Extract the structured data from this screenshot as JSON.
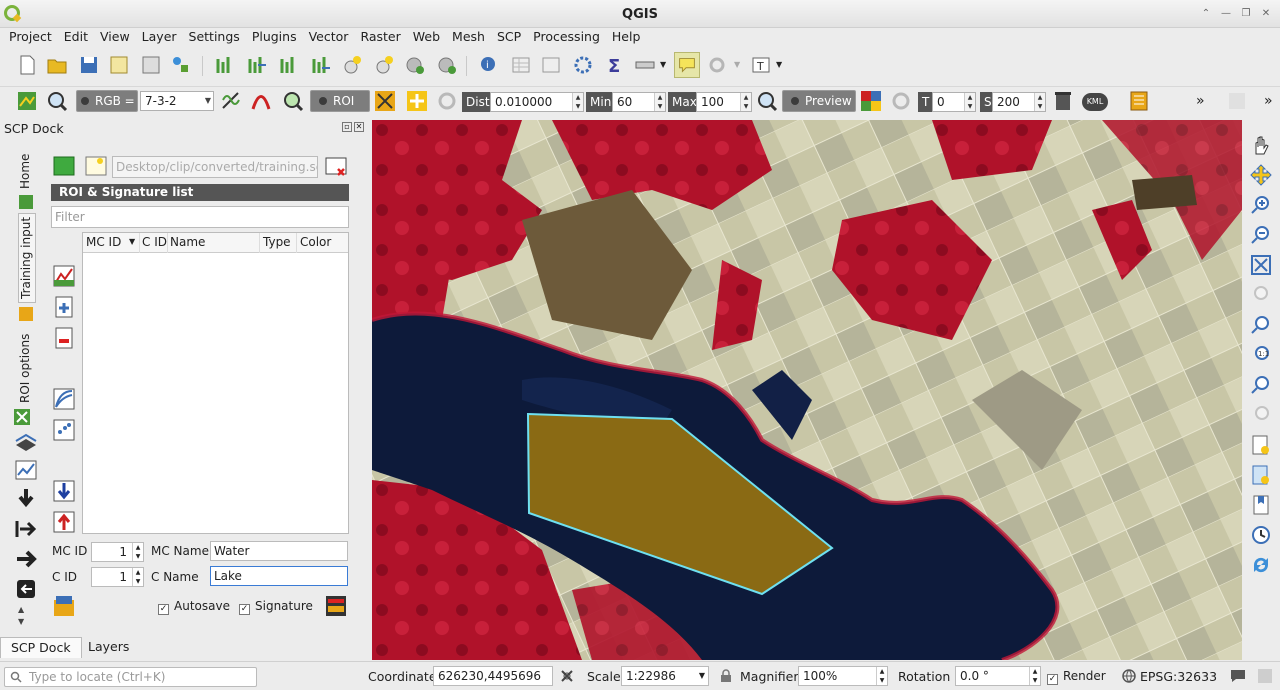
{
  "window": {
    "title": "QGIS"
  },
  "menu": [
    "Project",
    "Edit",
    "View",
    "Layer",
    "Settings",
    "Plugins",
    "Vector",
    "Raster",
    "Web",
    "Mesh",
    "SCP",
    "Processing",
    "Help"
  ],
  "scp_toolbar": {
    "rgb_label": "RGB =",
    "rgb_value": "7-3-2",
    "roi_button": "ROI",
    "dist_label": "Dist",
    "dist_value": "0.010000",
    "min_label": "Min",
    "min_value": "60",
    "max_label": "Max",
    "max_value": "100",
    "preview_button": "Preview",
    "t_label": "T",
    "t_value": "0",
    "s_label": "S",
    "s_value": "200",
    "kml_label": "KML",
    "overflow": "»"
  },
  "dock": {
    "title": "SCP Dock",
    "vertical_tabs": [
      "Home",
      "Training input",
      "ROI options"
    ],
    "training_file": "Desktop/clip/converted/training.scp",
    "roi_list_title": "ROI & Signature list",
    "filter_placeholder": "Filter",
    "table_headers": [
      "MC ID",
      "C ID",
      "Name",
      "Type",
      "Color"
    ],
    "table_rows": [],
    "mc_id_label": "MC ID",
    "mc_id_value": "1",
    "mc_name_label": "MC Name",
    "mc_name_value": "Water",
    "c_id_label": "C ID",
    "c_id_value": "1",
    "c_name_label": "C Name",
    "c_name_value": "Lake",
    "autosave_label": "Autosave",
    "autosave_checked": true,
    "signature_label": "Signature",
    "signature_checked": true
  },
  "bottom_tabs": [
    "SCP Dock",
    "Layers"
  ],
  "status": {
    "locator_placeholder": "Type to locate (Ctrl+K)",
    "coordinate_label": "Coordinate",
    "coordinate_value": "626230,4495696",
    "scale_label": "Scale",
    "scale_value": "1:22986",
    "magnifier_label": "Magnifier",
    "magnifier_value": "100%",
    "rotation_label": "Rotation",
    "rotation_value": "0.0 °",
    "render_label": "Render",
    "render_checked": true,
    "crs": "EPSG:32633"
  },
  "colors": {
    "roi_fill": "#8a6a14",
    "roi_stroke": "#6fe0f0",
    "water": "#0d1a3a",
    "vegetation_red": "#b0122a"
  }
}
